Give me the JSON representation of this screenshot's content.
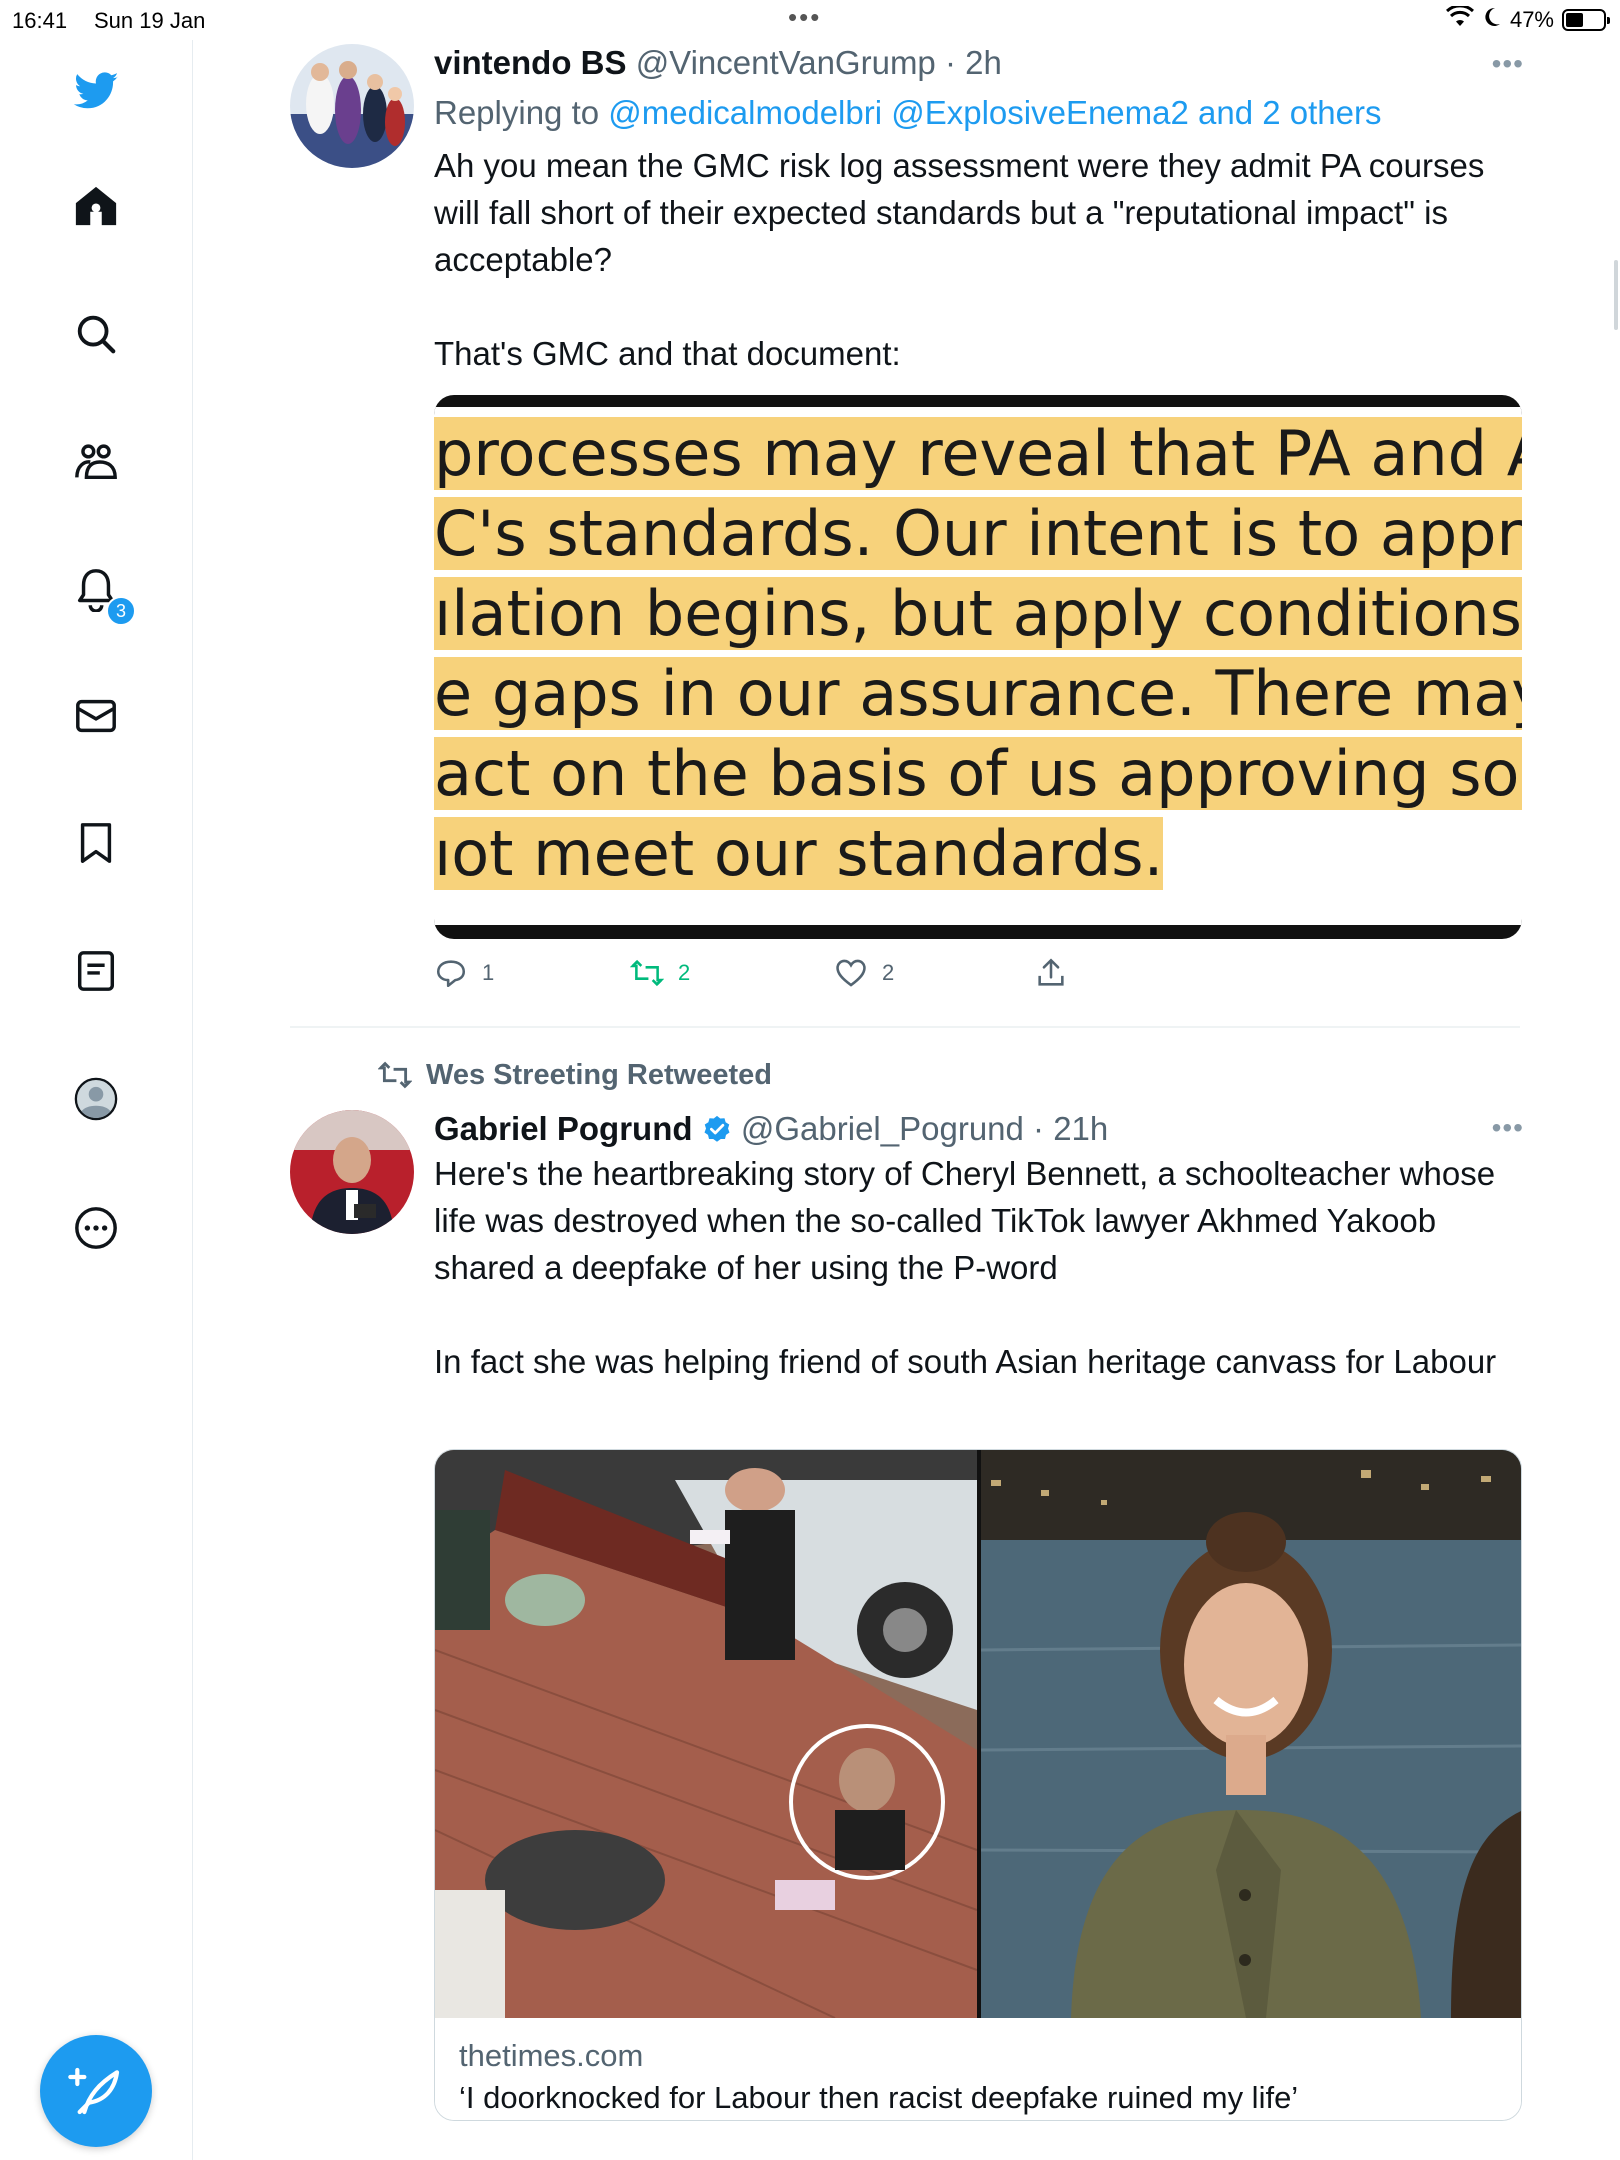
{
  "status_bar": {
    "time": "16:41",
    "date": "Sun 19 Jan",
    "battery": "47%",
    "battery_level": 0.47
  },
  "sidebar": {
    "items": [
      {
        "icon": "twitter-bird-icon"
      },
      {
        "icon": "home-icon"
      },
      {
        "icon": "search-icon"
      },
      {
        "icon": "communities-icon"
      },
      {
        "icon": "notifications-bell-icon"
      },
      {
        "icon": "messages-mail-icon"
      },
      {
        "icon": "bookmark-icon"
      },
      {
        "icon": "lists-icon"
      },
      {
        "icon": "profile-avatar-icon"
      },
      {
        "icon": "more-options-icon"
      }
    ],
    "notification_count": "3",
    "compose_icon": "compose-feather-icon",
    "accent_color": "#1d9bf0"
  },
  "tweets": [
    {
      "name": "vintendo BS",
      "handle": "@VincentVanGrump",
      "time": "· 2h",
      "replying_prefix": "Replying to",
      "replying_to": "@medicalmodelbri @ExplosiveEnema2 and 2 others",
      "text": "Ah you mean the GMC risk log assessment were they admit PA courses will fall short of their expected standards but a \"reputational impact\" is acceptable?\n\nThat's GMC and that document:",
      "image_lines": [
        "processes may reveal that PA and AA co",
        "C's standards. Our intent is to approve c",
        "ılation begins, but apply conditions to th",
        "e gaps in our assurance. There may be s",
        "act on the basis of us approving someth",
        "ıot meet our standards."
      ],
      "actions": {
        "replies": "1",
        "retweets": "2",
        "likes": "2"
      }
    },
    {
      "retweeted_by": "Wes Streeting Retweeted",
      "name": "Gabriel Pogrund",
      "verified": true,
      "handle": "@Gabriel_Pogrund",
      "time": "· 21h",
      "text": "Here's the heartbreaking story of Cheryl Bennett, a schoolteacher whose life was destroyed when the so-called TikTok lawyer Akhmed Yakoob shared a deepfake of her using the P-word\n\nIn fact she was helping friend of south Asian heritage canvass for Labour",
      "card": {
        "domain": "thetimes.com",
        "title": "‘I doorknocked for Labour then racist deepfake ruined my life’"
      }
    }
  ]
}
